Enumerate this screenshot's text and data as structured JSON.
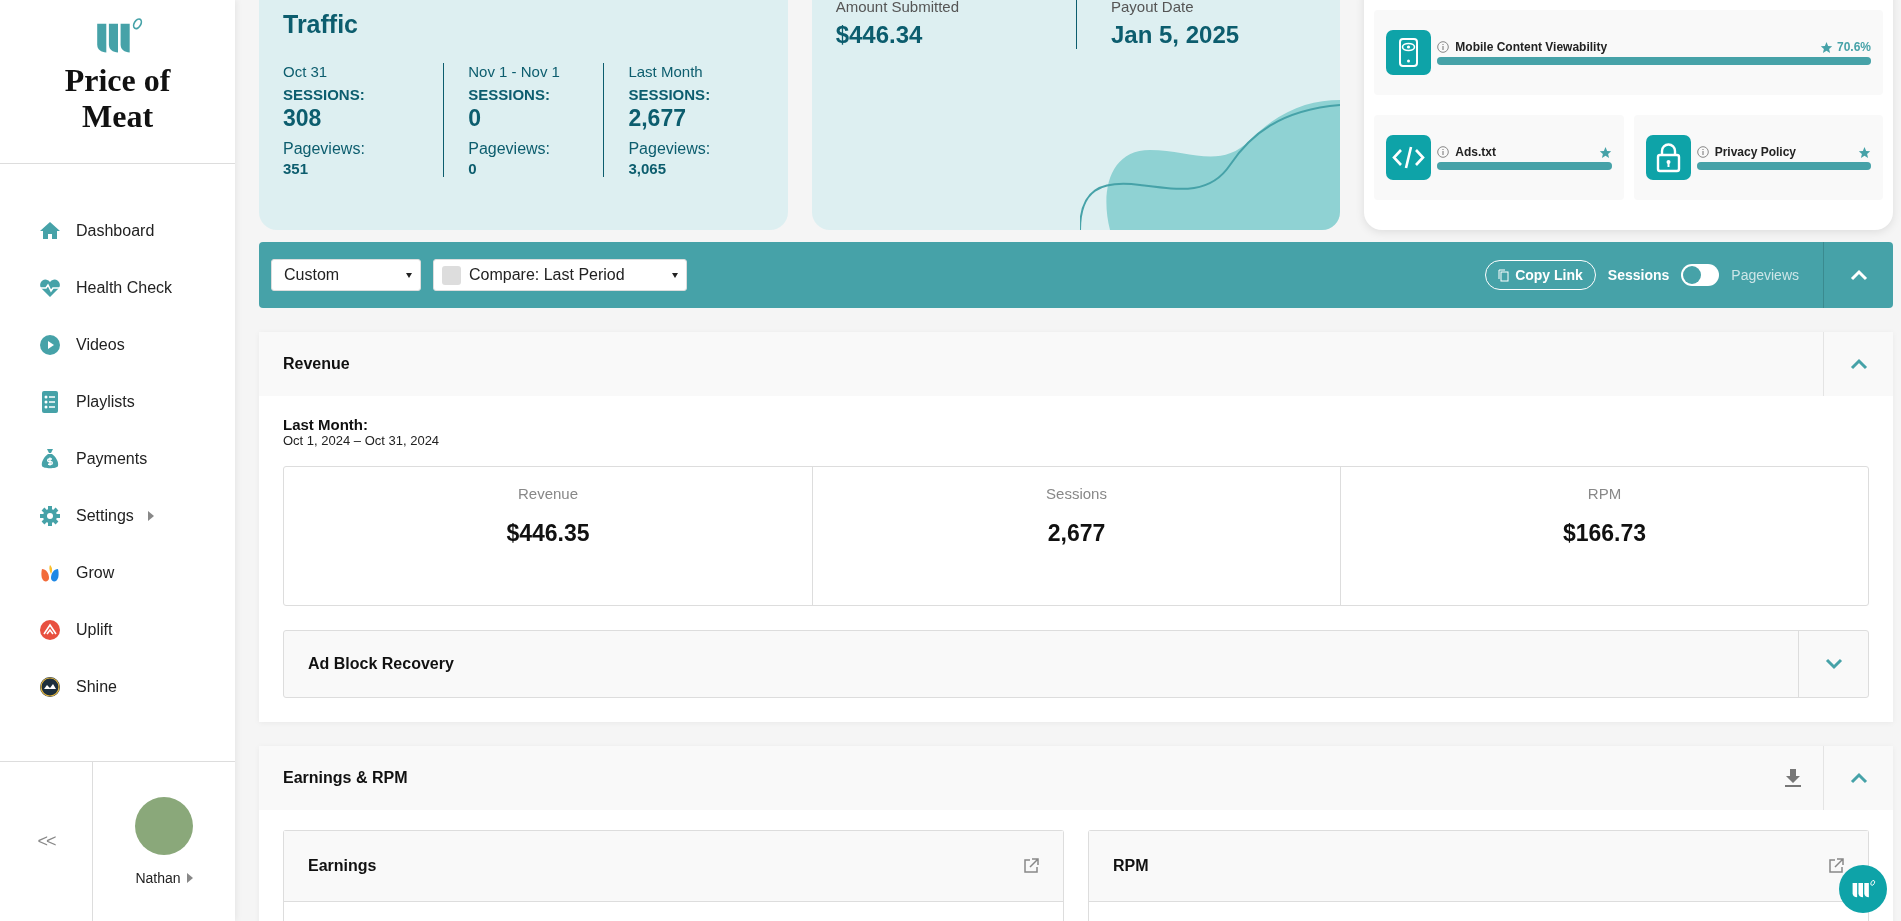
{
  "sidebar": {
    "brand": "Price of Meat",
    "nav": [
      {
        "label": "Dashboard",
        "has_submenu": false
      },
      {
        "label": "Health Check",
        "has_submenu": false
      },
      {
        "label": "Videos",
        "has_submenu": false
      },
      {
        "label": "Playlists",
        "has_submenu": false
      },
      {
        "label": "Payments",
        "has_submenu": false
      },
      {
        "label": "Settings",
        "has_submenu": true
      },
      {
        "label": "Grow",
        "has_submenu": false
      },
      {
        "label": "Uplift",
        "has_submenu": false
      },
      {
        "label": "Shine",
        "has_submenu": false
      }
    ],
    "collapse": "<<",
    "user": {
      "name": "Nathan"
    }
  },
  "traffic": {
    "title": "Traffic",
    "periods": [
      {
        "period": "Oct 31",
        "sessions_label": "SESSIONS:",
        "sessions": "308",
        "pageviews_label": "Pageviews:",
        "pageviews": "351"
      },
      {
        "period": "Nov 1 - Nov 1",
        "sessions_label": "SESSIONS:",
        "sessions": "0",
        "pageviews_label": "Pageviews:",
        "pageviews": "0"
      },
      {
        "period": "Last Month",
        "sessions_label": "SESSIONS:",
        "sessions": "2,677",
        "pageviews_label": "Pageviews:",
        "pageviews": "3,065"
      }
    ]
  },
  "payout": {
    "items": [
      {
        "label": "Amount Submitted",
        "value": "$446.34"
      },
      {
        "label": "Payout Date",
        "value": "Jan 5, 2025"
      }
    ]
  },
  "health": {
    "items": [
      {
        "label": "Mobile Content Viewability",
        "level": 1,
        "reading": "70.6%"
      },
      {
        "label": "Ads.txt",
        "level": 1
      },
      {
        "label": "Privacy Policy",
        "level": 1
      }
    ]
  },
  "toolbar": {
    "range_select": "Custom",
    "compare": {
      "label": "Compare: Last Period",
      "checked": false
    },
    "copy_link": "Copy Link",
    "metric_switch_on": false,
    "metric_toggle": [
      {
        "label": "Sessions",
        "selected": true
      },
      {
        "label": "Pageviews",
        "selected": false
      }
    ],
    "expanded": true
  },
  "revenue": {
    "title": "Revenue",
    "expanded": true,
    "period_label": "Last Month:",
    "period_range": "Oct 1, 2024 – Oct 31, 2024",
    "stats": [
      {
        "label": "Revenue",
        "value": "$446.35"
      },
      {
        "label": "Sessions",
        "value": "2,677"
      },
      {
        "label": "RPM",
        "value": "$166.73"
      }
    ],
    "sub_sections": [
      {
        "title": "Ad Block Recovery",
        "expanded": false
      }
    ]
  },
  "earnings_rpm": {
    "title": "Earnings & RPM",
    "expanded": true,
    "cards": [
      {
        "title": "Earnings"
      },
      {
        "title": "RPM"
      }
    ]
  }
}
